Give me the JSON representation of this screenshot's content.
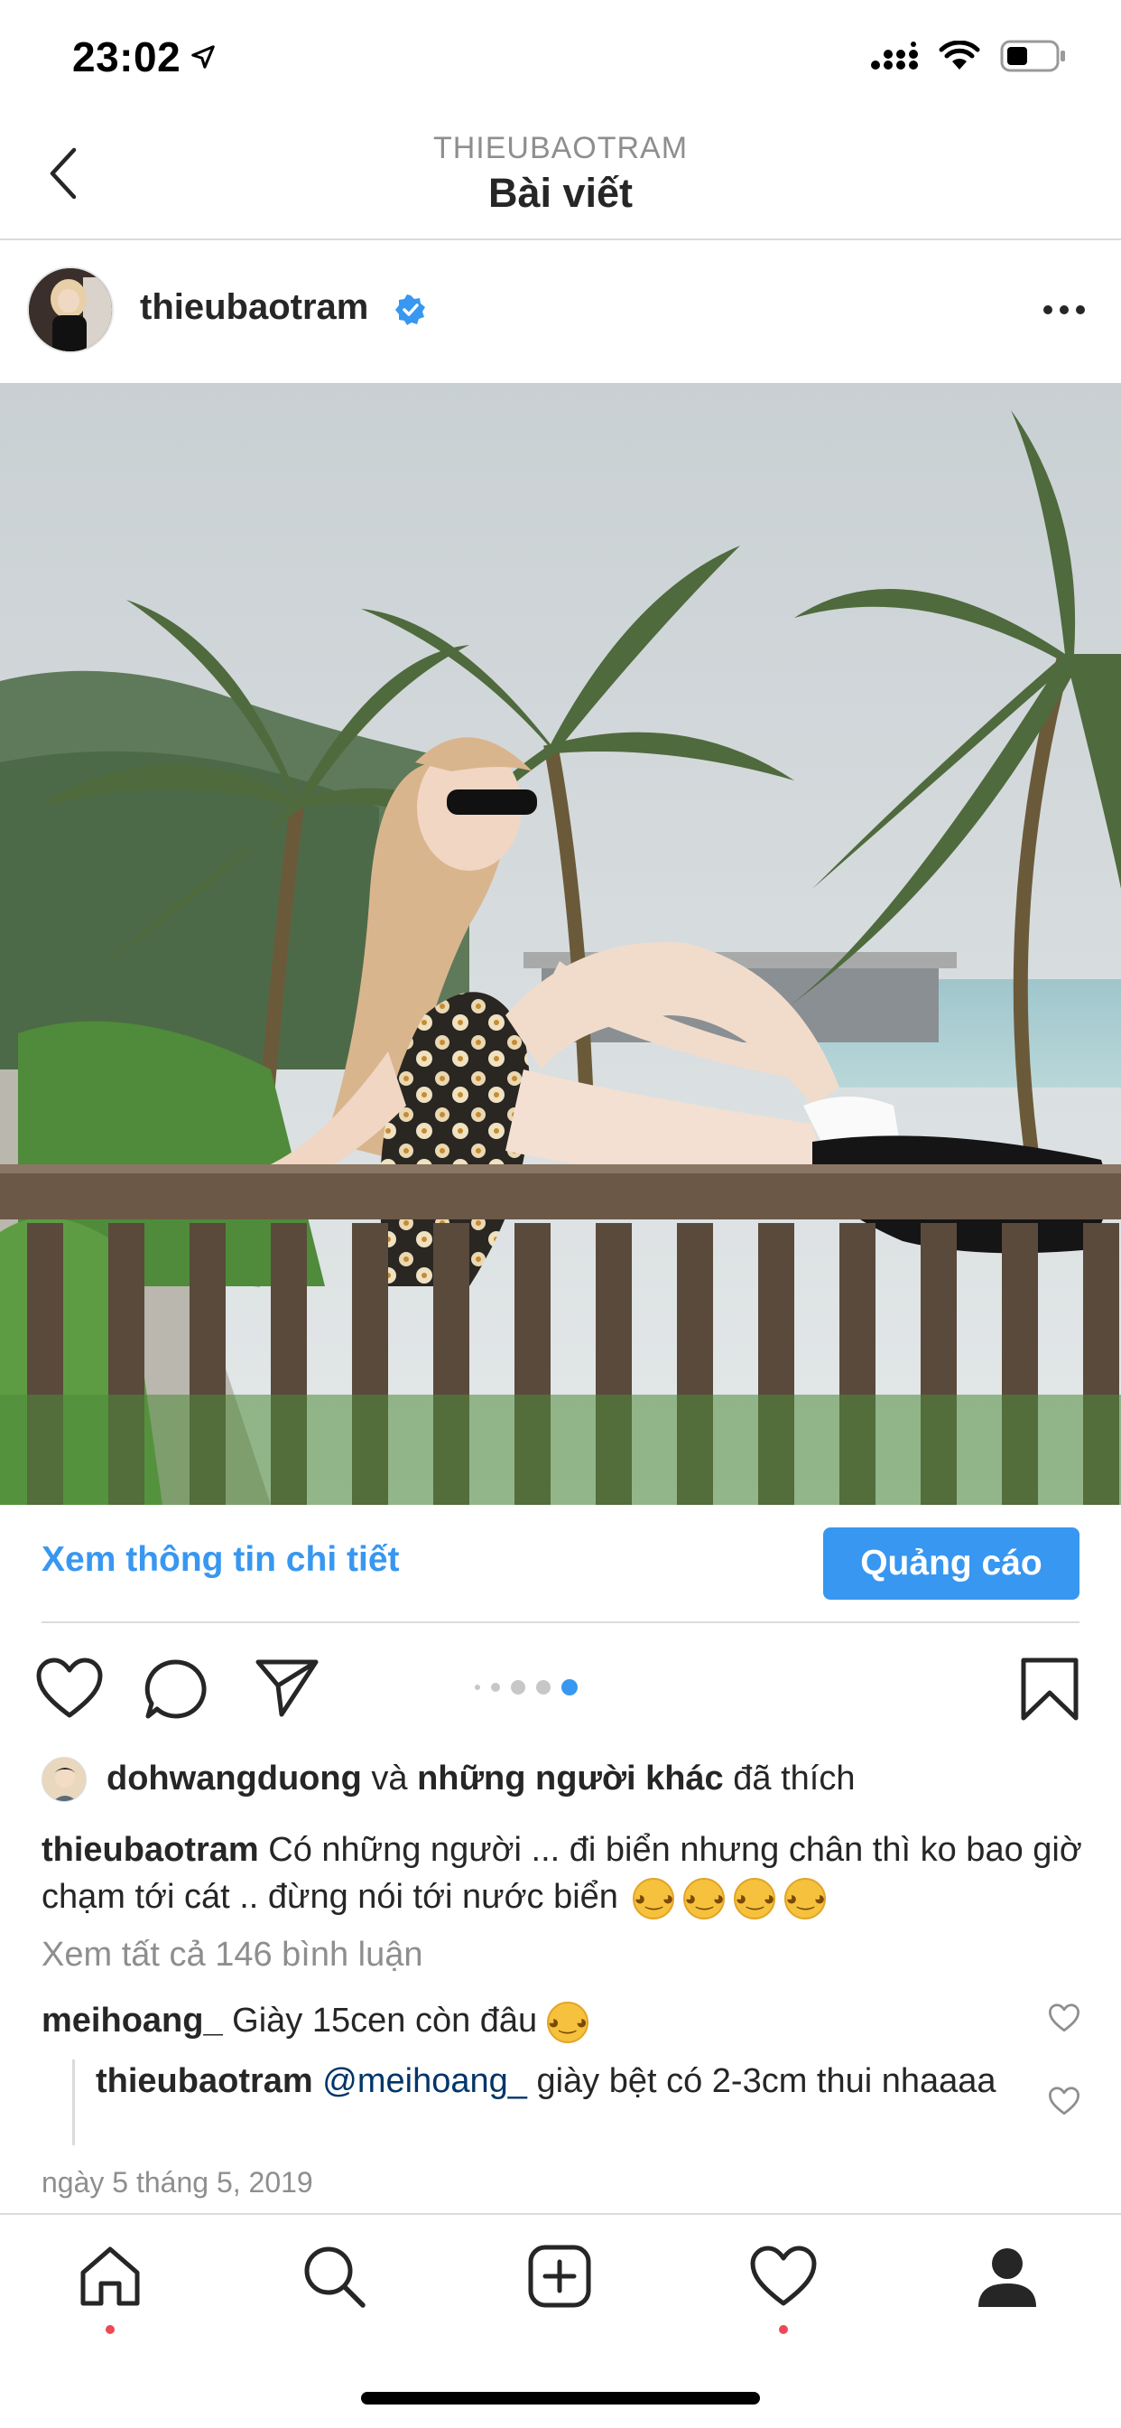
{
  "status_bar": {
    "time": "23:02"
  },
  "nav": {
    "subtitle": "THIEUBAOTRAM",
    "title": "Bài viết"
  },
  "post": {
    "username": "thieubaotram",
    "cta_link": "Xem thông tin chi tiết",
    "cta_button": "Quảng cáo",
    "carousel": {
      "count": 5,
      "active_index": 4
    },
    "likes": {
      "user": "dohwangduong",
      "connector": "và",
      "others": "những người khác",
      "suffix": "đã thích"
    },
    "caption": {
      "username": "thieubaotram",
      "text": "Có những người ... đi biển nhưng chân thì ko bao giờ chạm tới cát .. đừng nói tới nước biển",
      "emoji": [
        "rofl",
        "rofl",
        "rofl",
        "rofl"
      ]
    },
    "view_all_comments": "Xem tất cả 146 bình luận",
    "comments": [
      {
        "username": "meihoang_",
        "text": "Giày 15cen còn đâu",
        "emoji": "joy"
      },
      {
        "username": "thieubaotram",
        "mention": "@meihoang_",
        "text": "giày bệt có 2-3cm thui nhaaaa"
      }
    ],
    "date": "ngày 5 tháng 5, 2019"
  },
  "tabbar": {
    "items": [
      {
        "name": "home",
        "has_notification": true
      },
      {
        "name": "search",
        "has_notification": false
      },
      {
        "name": "create",
        "has_notification": false
      },
      {
        "name": "activity",
        "has_notification": true
      },
      {
        "name": "profile",
        "has_notification": false
      }
    ]
  },
  "colors": {
    "accent": "#3897f0",
    "text": "#262626",
    "secondary": "#8e8e8e",
    "notification": "#ed4956",
    "mention": "#003569"
  }
}
